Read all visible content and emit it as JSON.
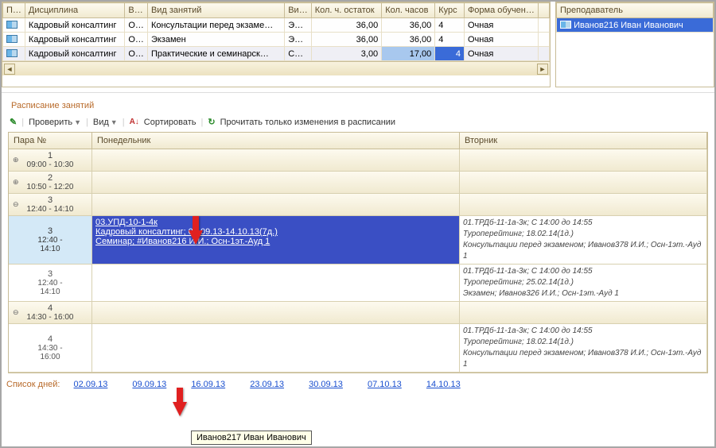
{
  "top_grid": {
    "headers": [
      "П…",
      "Дисциплина",
      "В…",
      "Вид занятий",
      "Ви…",
      "Кол. ч. остаток",
      "Кол. часов",
      "Курс",
      "Форма обучен…"
    ],
    "rows": [
      {
        "disc": "Кадровый консалтинг",
        "v": "О…",
        "type": "Консультации перед экзаме…",
        "vi": "Э…",
        "rest": "36,00",
        "hours": "36,00",
        "kurs": "4",
        "form": "Очная",
        "sel": false
      },
      {
        "disc": "Кадровый консалтинг",
        "v": "О…",
        "type": "Экзамен",
        "vi": "Э…",
        "rest": "36,00",
        "hours": "36,00",
        "kurs": "4",
        "form": "Очная",
        "sel": false
      },
      {
        "disc": "Кадровый консалтинг",
        "v": "О…",
        "type": "Практические и семинарск…",
        "vi": "С…",
        "rest": "3,00",
        "hours": "17,00",
        "kurs": "4",
        "form": "Очная",
        "sel": true
      }
    ]
  },
  "teacher_panel": {
    "header": "Преподаватель",
    "value": "Иванов216 Иван Иванович"
  },
  "section_title": "Расписание занятий",
  "toolbar": {
    "check": "Проверить",
    "view": "Вид",
    "sort": "Сортировать",
    "reread": "Прочитать только изменения в расписании"
  },
  "sched": {
    "col_pair": "Пара №",
    "col_mon": "Понедельник",
    "col_tue": "Вторник",
    "slots": [
      {
        "n": "1",
        "t": "09:00 - 10:30"
      },
      {
        "n": "2",
        "t": "10:50 - 12:20"
      },
      {
        "n": "3",
        "t": "12:40 - 14:10"
      },
      {
        "n": "4",
        "t": "14:30 - 16:00"
      }
    ],
    "sub3": {
      "n": "3",
      "t1": "12:40 -",
      "t2": "14:10"
    },
    "sub4": {
      "n": "4",
      "t1": "14:30 -",
      "t2": "16:00"
    },
    "mon_selected": {
      "l1": "03.УПД-10-1-4к",
      "l2": "Кадровый консалтинг; 02.09.13-14.10.13(7д.)",
      "l3": "Семинар; #Иванов216 И.И.; Осн-1эт.-Ауд 1"
    },
    "tue_block1": {
      "l1": "01.ТРДб-11-1а-3к; С 14:00 до 14:55",
      "l2": "Туроперейтинг; 18.02.14(1д.)",
      "l3": "Консультации перед экзаменом; Иванов378 И.И.; Осн-1эт.-Ауд 1"
    },
    "tue_block2": {
      "l1": "01.ТРДб-11-1а-3к; С 14:00 до 14:55",
      "l2": "Туроперейтинг; 25.02.14(1д.)",
      "l3": "Экзамен; Иванов326 И.И.; Осн-1эт.-Ауд 1"
    },
    "tue_block3": {
      "l1": "01.ТРДб-11-1а-3к; С 14:00 до 14:55",
      "l2": "Туроперейтинг; 18.02.14(1д.)",
      "l3": "Консультации перед экзаменом; Иванов378 И.И.; Осн-1эт.-Ауд 1"
    }
  },
  "daylist": {
    "label": "Список дней:",
    "days": [
      "02.09.13",
      "09.09.13",
      "16.09.13",
      "23.09.13",
      "30.09.13",
      "07.10.13",
      "14.10.13"
    ]
  },
  "tooltip": "Иванов217 Иван Иванович"
}
